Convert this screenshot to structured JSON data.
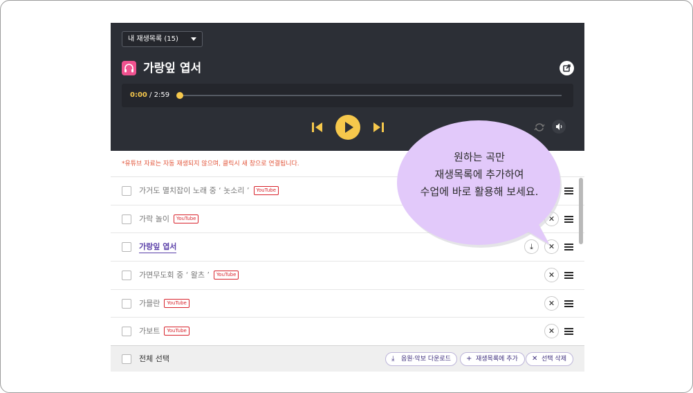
{
  "player": {
    "playlist_select": "내 재생목록 (15)",
    "title": "가랑잎 엽서",
    "time_current": "0:00",
    "time_separator": " / ",
    "time_total": "2:59",
    "progress": 0,
    "accent_color": "#f6c84c",
    "brand_color": "#f0528f",
    "icons": {
      "song": "headphones-icon",
      "share": "share-icon",
      "prev": "skip-previous-icon",
      "play": "play-icon",
      "next": "skip-next-icon",
      "repeat": "repeat-icon",
      "volume": "volume-icon"
    }
  },
  "notice": "*유튜브 자료는 자동 재생되지 않으며, 클릭시 새 창으로 연결됩니다.",
  "list": {
    "items": [
      {
        "title": "가거도 멸치잡이 노래 중 ‘ 놋소리 ’",
        "badge": "YouTube",
        "download": false,
        "active": false
      },
      {
        "title": "가락 놀이",
        "badge": "YouTube",
        "download": false,
        "active": false
      },
      {
        "title": "가랑잎 엽서",
        "badge": "",
        "download": true,
        "active": true
      },
      {
        "title": "가면무도회 중 ‘ 왈츠 ’",
        "badge": "YouTube",
        "download": false,
        "active": false
      },
      {
        "title": "가믈란",
        "badge": "YouTube",
        "download": false,
        "active": false
      },
      {
        "title": "가보트",
        "badge": "YouTube",
        "download": false,
        "active": false
      }
    ],
    "remove_symbol": "✕",
    "download_symbol": "⤓"
  },
  "footer": {
    "select_all": "전체 선택",
    "download_label": "음원·악보 다운로드",
    "add_label": "재생목록에 추가",
    "delete_label": "선택 삭제",
    "download_icon": "⤓",
    "add_icon": "+",
    "delete_icon": "✕"
  },
  "bubble": {
    "line1": "원하는 곡만",
    "line2": "재생목록에 추가하여",
    "line3": "수업에 바로 활용해 보세요.",
    "color": "#e2c9fa"
  }
}
